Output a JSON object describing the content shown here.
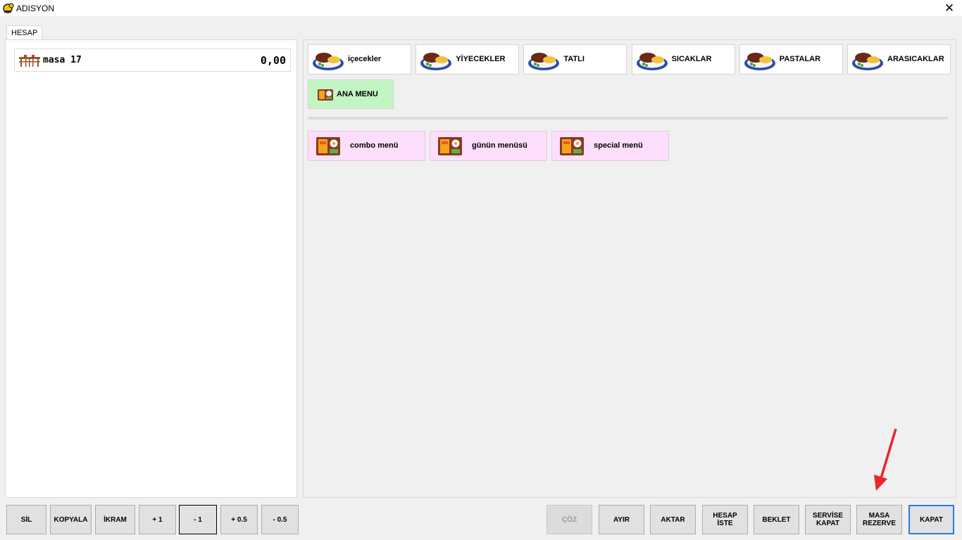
{
  "window": {
    "title": "ADISYON",
    "close_symbol": "✕"
  },
  "tab": {
    "label": "HESAP"
  },
  "order": {
    "table_name": "masa 17",
    "amount": "0,00"
  },
  "categories": [
    {
      "label": "içecekler",
      "icon": "food-plate-icon"
    },
    {
      "label": "YİYECEKLER",
      "icon": "food-plate-icon"
    },
    {
      "label": "TATLI",
      "icon": "food-plate-icon"
    },
    {
      "label": "SICAKLAR",
      "icon": "food-plate-icon"
    },
    {
      "label": "PASTALAR",
      "icon": "food-plate-icon"
    },
    {
      "label": "ARASICAKLAR",
      "icon": "food-plate-icon"
    }
  ],
  "main_menu": {
    "label": "ANA MENU",
    "icon": "bento-icon",
    "color": "#c2f5c2"
  },
  "menus": [
    {
      "label": "combo menü",
      "icon": "bento-icon"
    },
    {
      "label": "günün menüsü",
      "icon": "bento-icon"
    },
    {
      "label": "special menü",
      "icon": "bento-icon"
    }
  ],
  "left_buttons": [
    "SİL",
    "KOPYALA",
    "İKRAM",
    "+ 1",
    "- 1",
    "+ 0.5",
    "- 0.5"
  ],
  "right_buttons": [
    "ÇÖZ",
    "AYIR",
    "AKTAR",
    "HESAP\nİSTE",
    "BEKLET",
    "SERVİSE\nKAPAT",
    "MASA\nREZERVE",
    "KAPAT"
  ],
  "colors": {
    "menu_pink": "#fddffd",
    "annotation_arrow": "#e8262a",
    "default_button_border": "#2a7fd4"
  }
}
